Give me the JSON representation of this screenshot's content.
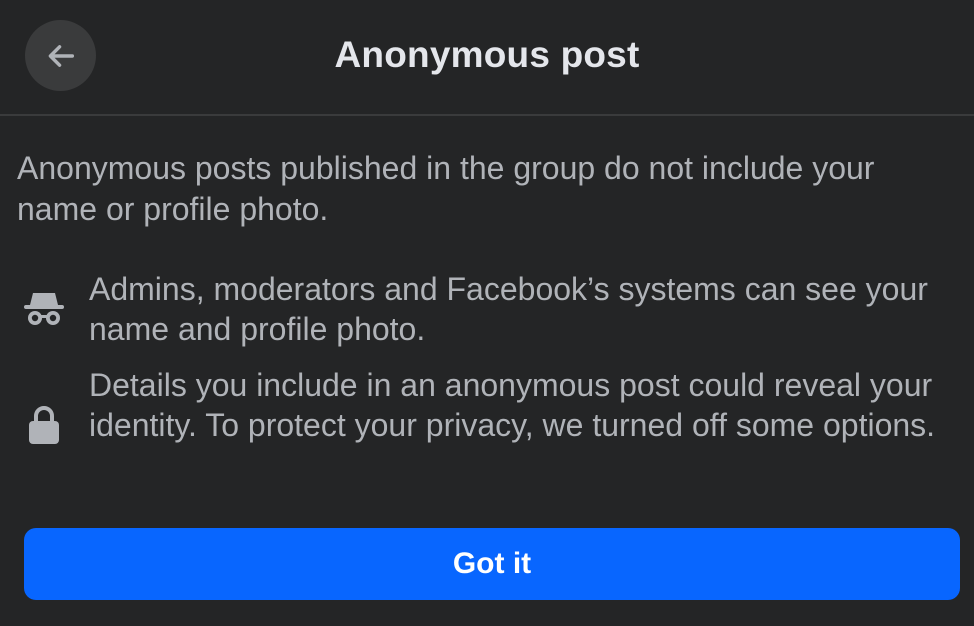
{
  "header": {
    "title": "Anonymous post",
    "back_icon": "arrow-left-icon"
  },
  "intro_text": "Anonymous posts published in the group do not include your name or profile photo.",
  "info_items": [
    {
      "icon": "incognito-icon",
      "text": "Admins, moderators and Facebook’s systems can see your name and profile photo."
    },
    {
      "icon": "lock-icon",
      "text": "Details you include in an anonymous post could reveal your identity. To protect your privacy, we turned off some options."
    }
  ],
  "primary_button": {
    "label": "Got it"
  },
  "colors": {
    "background": "#242526",
    "divider": "#3a3b3c",
    "title_text": "#e4e6eb",
    "body_text": "#b0b3b8",
    "icon": "#b0b3b8",
    "button": "#0866ff",
    "button_text": "#ffffff"
  }
}
